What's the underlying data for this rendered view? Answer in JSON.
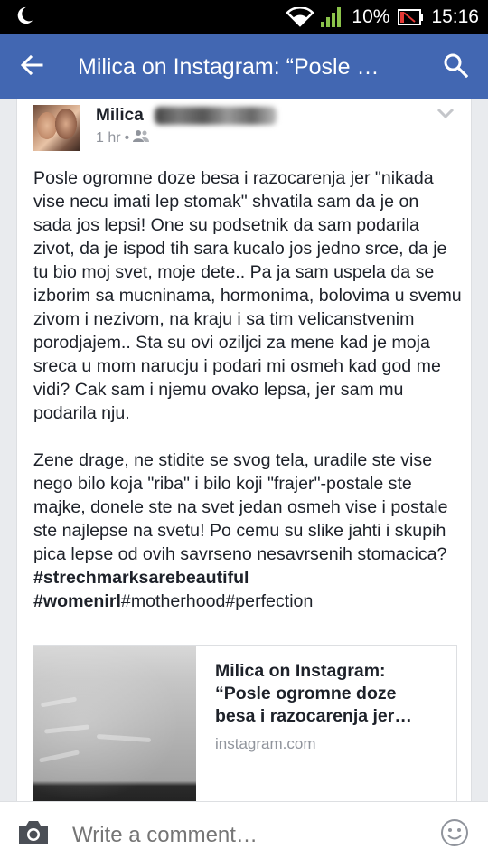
{
  "status_bar": {
    "battery_percent": "10%",
    "time": "15:16",
    "icons": [
      "moon-icon",
      "wifi-icon",
      "signal-icon",
      "battery-icon"
    ]
  },
  "app_bar": {
    "title": "Milica on Instagram: “Posle …",
    "icons": [
      "back-arrow-icon",
      "search-icon"
    ]
  },
  "post": {
    "author_first_name": "Milica",
    "time_ago": "1 hr",
    "separator": "•",
    "audience_icon": "friends-icon",
    "paragraph_1": "Posle ogromne doze besa i razocarenja jer \"nikada vise necu imati lep stomak\" shvatila sam da je on sada jos lepsi! One su podsetnik da sam podarila zivot, da je ispod tih sara kucalo jos jedno srce, da je tu bio moj svet, moje dete.. Pa ja sam uspela da se izborim sa mucninama, hormonima, bolovima u svemu zivom i nezivom, na kraju i sa tim velicanstvenim porodjajem.. Sta su ovi oziljci za mene kad je moja sreca u mom narucju i podari mi osmeh kad god me vidi? Cak sam i njemu ovako lepsa, jer sam mu podarila nju.",
    "paragraph_2": "Zene drage, ne stidite se svog tela, uradile ste vise nego bilo koja \"riba\" i bilo koji \"frajer\"-postale ste majke, donele ste na svet jedan osmeh vise i postale ste najlepse na svetu! Po cemu su slike jahti i skupih pica lepse od ovih savrseno nesavrsenih stomacica?",
    "hashtag_1": "#strechmarksarebeautiful",
    "hashtag_2": "#womenirl",
    "hashtag_3": "#motherhood",
    "hashtag_4": "#perfection"
  },
  "link_preview": {
    "title": "Milica on Instagram: “Posle ogromne doze besa i razocarenja jer…",
    "domain": "instagram.com"
  },
  "comment_bar": {
    "placeholder": "Write a comment…",
    "icons": [
      "camera-icon",
      "emoji-icon"
    ]
  },
  "colors": {
    "app_bar": "#4267b2",
    "status_bar": "#000000",
    "text_primary": "#1d2129",
    "text_secondary": "#90949c"
  }
}
